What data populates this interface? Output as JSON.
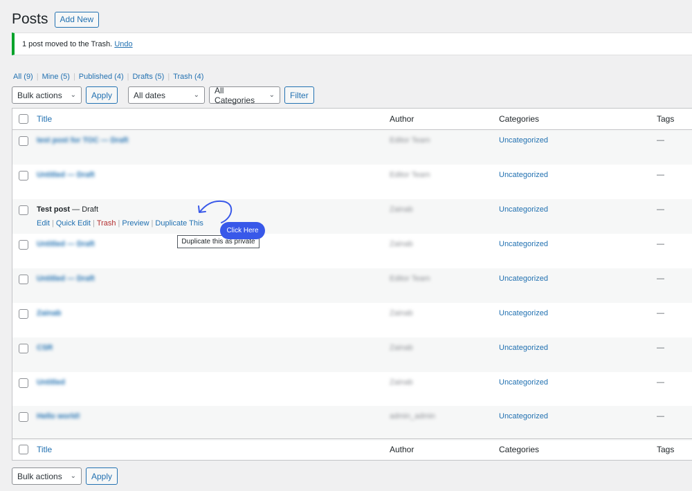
{
  "header": {
    "title": "Posts",
    "add_new": "Add New"
  },
  "notice": {
    "message": "1 post moved to the Trash.",
    "undo": "Undo"
  },
  "views": [
    {
      "label": "All (9)"
    },
    {
      "label": "Mine (5)"
    },
    {
      "label": "Published (4)"
    },
    {
      "label": "Drafts (5)"
    },
    {
      "label": "Trash (4)"
    }
  ],
  "view_separator": "|",
  "tablenav_top": {
    "bulk_actions": "Bulk actions",
    "apply": "Apply",
    "dates": "All dates",
    "categories": "All Categories",
    "filter": "Filter"
  },
  "tablenav_bottom": {
    "bulk_actions": "Bulk actions",
    "apply": "Apply"
  },
  "columns": {
    "title": "Title",
    "author": "Author",
    "categories": "Categories",
    "tags": "Tags"
  },
  "rows": [
    {
      "title": "test post for TOC — Draft",
      "author": "Editor Team",
      "category": "Uncategorized",
      "tags": "—"
    },
    {
      "title": "Untitled — Draft",
      "author": "Editor Team",
      "category": "Uncategorized",
      "tags": "—"
    },
    {
      "title": "Test post",
      "state": " — Draft",
      "author": "Zainab",
      "category": "Uncategorized",
      "tags": "—"
    },
    {
      "title": "Untitled — Draft",
      "author": "Zainab",
      "category": "Uncategorized",
      "tags": "—"
    },
    {
      "title": "Untitled — Draft",
      "author": "Editor Team",
      "category": "Uncategorized",
      "tags": "—"
    },
    {
      "title": "Zainab",
      "author": "Zainab",
      "category": "Uncategorized",
      "tags": "—"
    },
    {
      "title": "CSR",
      "author": "Zainab",
      "category": "Uncategorized",
      "tags": "—"
    },
    {
      "title": "Untitled",
      "author": "Zainab",
      "category": "Uncategorized",
      "tags": "—"
    },
    {
      "title": "Hello world!",
      "author": "admin_admin",
      "category": "Uncategorized",
      "tags": "—"
    }
  ],
  "row_actions": {
    "edit": "Edit",
    "quick_edit": "Quick Edit",
    "trash": "Trash",
    "preview": "Preview",
    "duplicate": "Duplicate This",
    "separator": "|"
  },
  "callout": {
    "button": "Click Here",
    "tooltip": "Duplicate this as private"
  },
  "colors": {
    "accent": "#2271b1",
    "success": "#00a32a",
    "danger": "#b32d2e",
    "callout": "#3858e9"
  }
}
